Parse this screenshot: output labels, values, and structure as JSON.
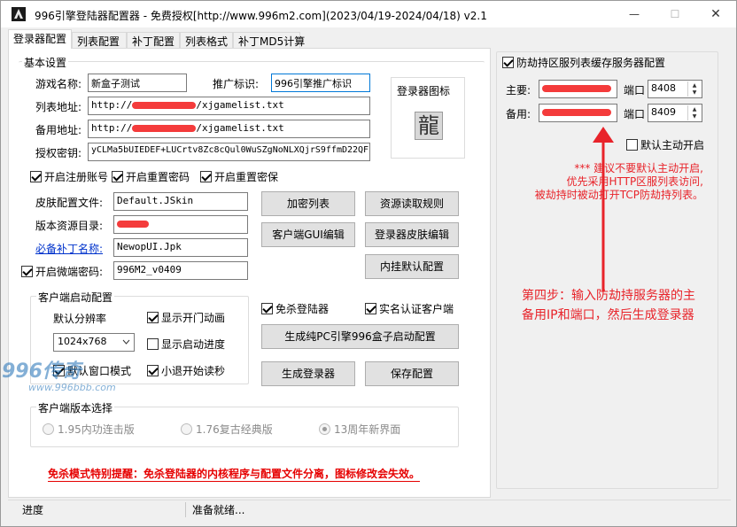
{
  "window": {
    "title": "996引擎登陆器配置器 - 免费授权[http://www.996m2.com](2023/04/19-2024/04/18) v2.1",
    "minimize_label": "—",
    "maximize_label": "☐",
    "close_label": "✕"
  },
  "tabs": [
    {
      "label": "登录器配置"
    },
    {
      "label": "列表配置"
    },
    {
      "label": "补丁配置"
    },
    {
      "label": "列表格式"
    },
    {
      "label": "补丁MD5计算"
    }
  ],
  "basic": {
    "group_title": "基本设置",
    "game_name_label": "游戏名称:",
    "game_name_value": "新盒子测试",
    "promo_label": "推广标识:",
    "promo_value": "996引擎推广标识",
    "list_url_label": "列表地址:",
    "list_url_prefix": "http://",
    "list_url_suffix": "/xjgamelist.txt",
    "backup_url_label": "备用地址:",
    "backup_url_prefix": "http://",
    "backup_url_suffix": "/xjgamelist.txt",
    "auth_key_label": "授权密钥:",
    "auth_key_value": "yCLMa5bUIEDEF+LUCrtv8Zc8cQul0WuSZgNoNLXQjrS9ffmD22QF",
    "icon_label": "登录器图标",
    "icon_glyph": "龍"
  },
  "checks_top": [
    {
      "label": "开启注册账号",
      "checked": true
    },
    {
      "label": "开启重置密码",
      "checked": true
    },
    {
      "label": "开启重置密保",
      "checked": true
    }
  ],
  "files": {
    "skin_label": "皮肤配置文件:",
    "skin_value": "Default.JSkin",
    "res_label": "版本资源目录:",
    "patch_label": "必备补丁名称:",
    "patch_value": "NewopUI.Jpk",
    "micro_label": "开启微端密码:",
    "micro_checked": true,
    "micro_value": "996M2_v0409"
  },
  "buttons": {
    "encrypt_list": "加密列表",
    "resource_rules": "资源读取规则",
    "client_gui": "客户端GUI编辑",
    "skin_edit": "登录器皮肤编辑",
    "plugin_default": "内挂默认配置",
    "gen_pc": "生成纯PC引擎996盒子启动配置",
    "gen_login": "生成登录器",
    "save_config": "保存配置"
  },
  "client_start": {
    "group_title": "客户端启动配置",
    "resolution_label": "默认分辨率",
    "resolution_value": "1024x768",
    "show_door_anim": {
      "label": "显示开门动画",
      "checked": true
    },
    "show_progress": {
      "label": "显示启动进度",
      "checked": false
    },
    "window_mode": {
      "label": "默认窗口模式",
      "checked": true
    },
    "small_exit": {
      "label": "小退开始读秒",
      "checked": true
    }
  },
  "checks_mid": [
    {
      "label": "免杀登陆器",
      "checked": true
    },
    {
      "label": "实名认证客户端",
      "checked": true
    }
  ],
  "client_version": {
    "group_title": "客户端版本选择",
    "options": [
      {
        "label": "1.95内功连击版",
        "selected": false
      },
      {
        "label": "1.76复古经典版",
        "selected": false
      },
      {
        "label": "13周年新界面",
        "selected": true
      }
    ]
  },
  "warning_text": "免杀模式特别提醒：免杀登陆器的内核程序与配置文件分离，图标修改会失效。",
  "right": {
    "enable_label": "防劫持区服列表缓存服务器配置",
    "enable_checked": true,
    "primary_label": "主要:",
    "port_label": "端口",
    "primary_port": "8408",
    "backup_label": "备用:",
    "backup_port": "8409",
    "default_on_label": "默认主动开启",
    "default_on_checked": false,
    "note_line1": "*** 建议不要默认主动开启,",
    "note_line2": "优先采用HTTP区服列表访问,",
    "note_line3": "被劫持时被动打开TCP防劫持列表。",
    "step_line1": "第四步：输入防劫持服务器的主",
    "step_line2": "备用IP和端口，然后生成登录器"
  },
  "status": {
    "progress_label": "进度",
    "ready_text": "准备就绪..."
  },
  "watermark": {
    "text": "996传奇",
    "url": "www.996bbb.com"
  },
  "colors": {
    "annotation_red": "#e8232a",
    "warning_red": "#e60000",
    "link_blue": "#0033cc"
  }
}
